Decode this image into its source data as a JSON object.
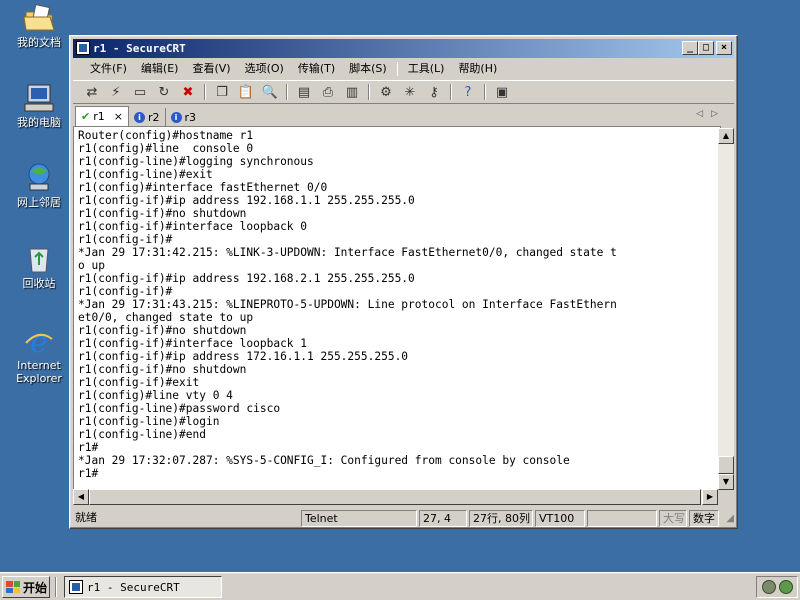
{
  "desktop": {
    "icons": [
      {
        "label": "我的文档",
        "icon": "folder-documents-icon"
      },
      {
        "label": "我的电脑",
        "icon": "computer-icon"
      },
      {
        "label": "网上邻居",
        "icon": "network-icon"
      },
      {
        "label": "回收站",
        "icon": "recycle-bin-icon"
      },
      {
        "label": "Internet Explorer",
        "icon": "internet-explorer-icon"
      }
    ]
  },
  "window": {
    "title": "r1 - SecureCRT",
    "controls": {
      "minimize": "_",
      "maximize": "□",
      "close": "×"
    }
  },
  "menubar": {
    "items": [
      "文件(F)",
      "编辑(E)",
      "查看(V)",
      "选项(O)",
      "传输(T)",
      "脚本(S)",
      "工具(L)",
      "帮助(H)"
    ]
  },
  "toolbar": {
    "icons": [
      "connect-icon",
      "quick-connect-icon",
      "connect-in-tab-icon",
      "reconnect-icon",
      "disconnect-icon",
      "copy-icon",
      "paste-icon",
      "find-icon",
      "print-setup-icon",
      "print-icon",
      "print-selection-icon",
      "session-options-icon",
      "global-options-icon",
      "key-map-icon",
      "help-icon",
      "chat-window-icon"
    ]
  },
  "tabs": [
    {
      "label": "r1",
      "status": "connected",
      "active": true,
      "close": "×"
    },
    {
      "label": "r2",
      "status": "info",
      "active": false
    },
    {
      "label": "r3",
      "status": "info",
      "active": false
    }
  ],
  "tab_nav": {
    "prev": "◁",
    "next": "▷"
  },
  "terminal": {
    "lines": [
      "Router(config)#hostname r1",
      "r1(config)#line  console 0",
      "r1(config-line)#logging synchronous",
      "r1(config-line)#exit",
      "r1(config)#interface fastEthernet 0/0",
      "r1(config-if)#ip address 192.168.1.1 255.255.255.0",
      "r1(config-if)#no shutdown",
      "r1(config-if)#interface loopback 0",
      "r1(config-if)#",
      "*Jan 29 17:31:42.215: %LINK-3-UPDOWN: Interface FastEthernet0/0, changed state t",
      "o up",
      "r1(config-if)#ip address 192.168.2.1 255.255.255.0",
      "r1(config-if)#",
      "*Jan 29 17:31:43.215: %LINEPROTO-5-UPDOWN: Line protocol on Interface FastEthern",
      "et0/0, changed state to up",
      "r1(config-if)#no shutdown",
      "r1(config-if)#interface loopback 1",
      "r1(config-if)#ip address 172.16.1.1 255.255.255.0",
      "r1(config-if)#no shutdown",
      "r1(config-if)#exit",
      "r1(config)#line vty 0 4",
      "r1(config-line)#password cisco",
      "r1(config-line)#login",
      "r1(config-line)#end",
      "r1#",
      "*Jan 29 17:32:07.287: %SYS-5-CONFIG_I: Configured from console by console",
      "r1#"
    ]
  },
  "statusbar": {
    "ready": "就绪",
    "protocol": "Telnet",
    "cursor": "27,  4",
    "rows_cols": "27行, 80列",
    "emulation": "VT100",
    "blank": "",
    "caps": "大写",
    "num": "数字"
  },
  "taskbar": {
    "start_label": "开始",
    "task_label": "r1 - SecureCRT"
  }
}
